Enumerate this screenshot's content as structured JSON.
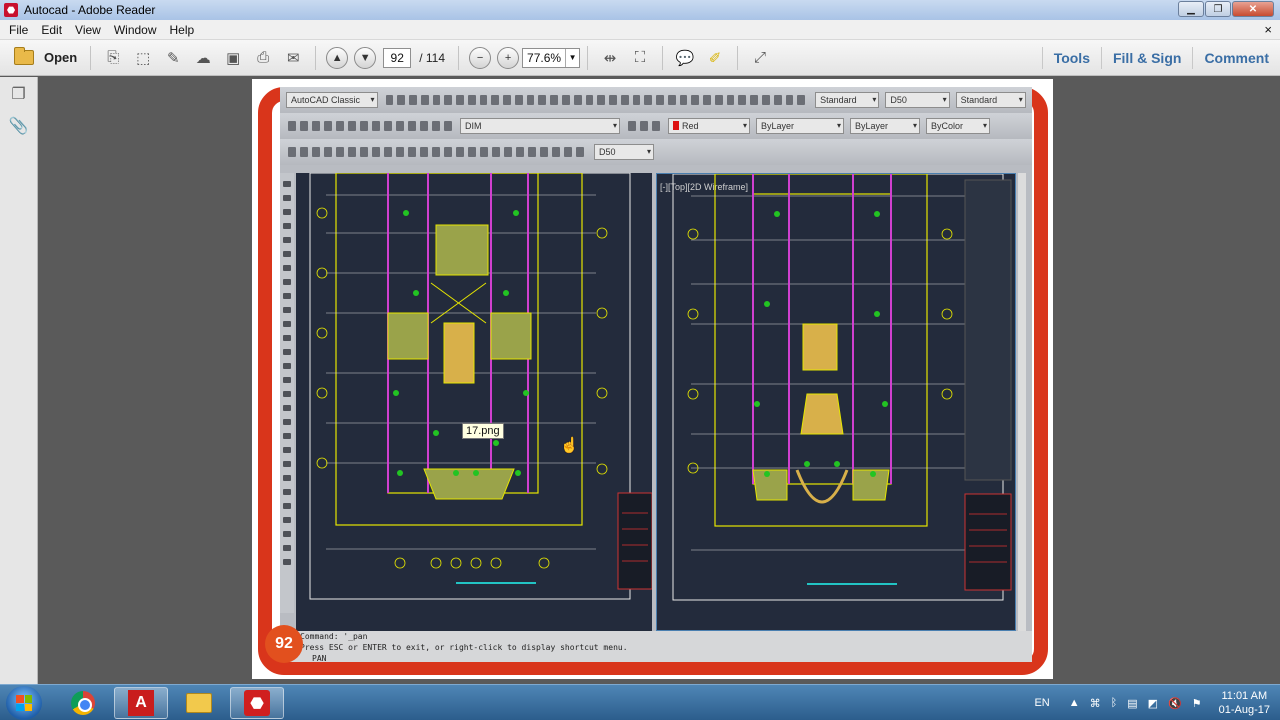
{
  "window": {
    "title": "Autocad - Adobe Reader",
    "min": "▁",
    "max": "❐",
    "close": "✕"
  },
  "menu": {
    "items": [
      "File",
      "Edit",
      "View",
      "Window",
      "Help"
    ],
    "close": "×"
  },
  "toolbar": {
    "open_label": "Open",
    "page_current": "92",
    "page_total": "/ 114",
    "zoom": "77.6%",
    "right_links": [
      "Tools",
      "Fill & Sign",
      "Comment"
    ]
  },
  "autocad": {
    "workspace": "AutoCAD Classic",
    "text_style": "Standard",
    "dim_style": "D50",
    "table_style": "Standard",
    "layer": "DIM",
    "color": "Red",
    "linetype": "ByLayer",
    "lineweight": "ByLayer",
    "plotstyle": "ByColor",
    "scale": "D50",
    "viewport_label": "[-][Top][2D Wireframe]",
    "cmd_line1": "Command: '_pan",
    "cmd_line2": "Press ESC or ENTER to exit, or right-click to display shortcut menu.",
    "cmd_prompt": "PAN"
  },
  "tooltip": "17.png",
  "page_badge": "92",
  "taskbar": {
    "lang": "EN",
    "time": "11:01 AM",
    "date": "01-Aug-17"
  },
  "colors": {
    "accent_link": "#3a6ea5",
    "frame_red": "#d9351b",
    "badge": "#e2501e"
  }
}
